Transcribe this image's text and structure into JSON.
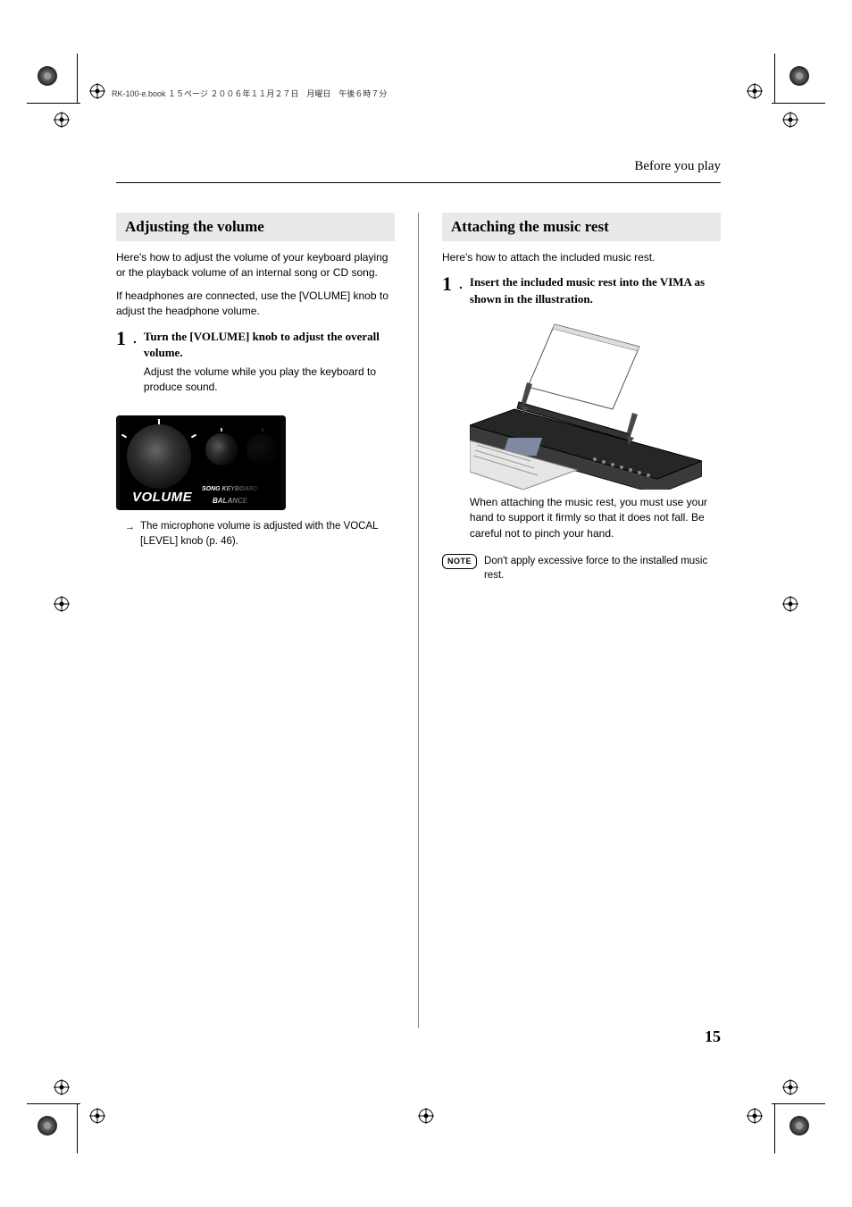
{
  "book_header": "RK-100-e.book １５ページ ２００６年１１月２７日　月曜日　午後６時７分",
  "page_header": "Before you play",
  "page_number": "15",
  "left": {
    "section_title": "Adjusting the volume",
    "intro1": "Here's how to adjust the volume of your keyboard playing or the playback volume of an internal song or CD song.",
    "intro2": "If headphones are connected, use the [VOLUME] knob to adjust the headphone volume.",
    "step_num": "1",
    "step_dot": ".",
    "step_head": "Turn the [VOLUME] knob to adjust the overall volume.",
    "step_body": "Adjust the volume while you play the keyboard to produce sound.",
    "vol_label": "VOLUME",
    "bal_label": "BALANCE",
    "sk_label": "SONG   KEYBOARD",
    "arrow_note": "The microphone volume is adjusted with the VOCAL [LEVEL] knob (p. 46)."
  },
  "right": {
    "section_title": "Attaching the music rest",
    "intro": "Here's how to attach the included music rest.",
    "step_num": "1",
    "step_dot": ".",
    "step_head": "Insert the included music rest into the VIMA as shown in the illustration.",
    "caution": "When attaching the music rest, you must use your hand to support it firmly so that it does not fall. Be careful not to pinch your hand.",
    "note_label": "NOTE",
    "note_text": "Don't apply excessive force to the installed music rest."
  }
}
